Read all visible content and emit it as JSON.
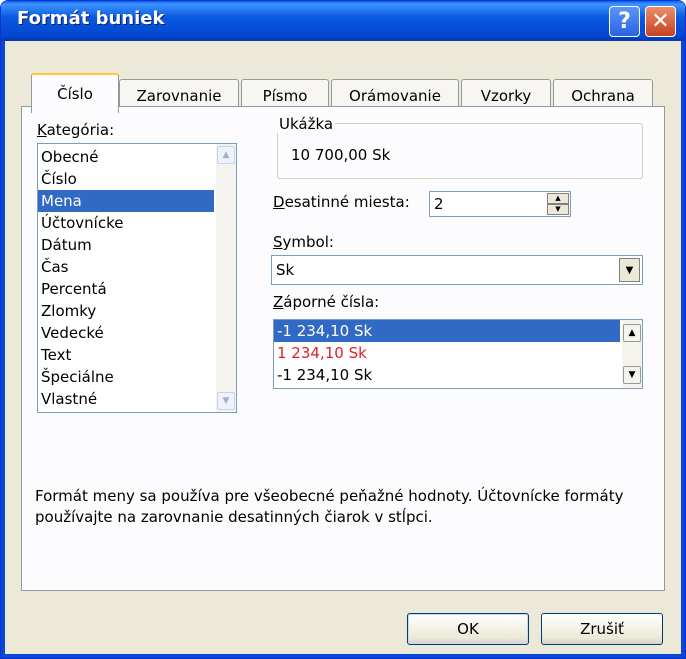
{
  "window": {
    "title": "Formát buniek",
    "help_glyph": "?",
    "close_glyph": "✕"
  },
  "tabs": [
    {
      "label": "Číslo",
      "active": true
    },
    {
      "label": "Zarovnanie",
      "active": false
    },
    {
      "label": "Písmo",
      "active": false
    },
    {
      "label": "Orámovanie",
      "active": false
    },
    {
      "label": "Vzorky",
      "active": false
    },
    {
      "label": "Ochrana",
      "active": false
    }
  ],
  "category": {
    "label": "Kategória:",
    "items": [
      "Obecné",
      "Číslo",
      "Mena",
      "Účtovnícke",
      "Dátum",
      "Čas",
      "Percentá",
      "Zlomky",
      "Vedecké",
      "Text",
      "Špeciálne",
      "Vlastné"
    ],
    "selected": "Mena"
  },
  "sample": {
    "label": "Ukážka",
    "value": "10 700,00 Sk"
  },
  "decimals": {
    "label": "Desatinné miesta:",
    "value": "2"
  },
  "symbol": {
    "label": "Symbol:",
    "value": "Sk"
  },
  "negative": {
    "label": "Záporné čísla:",
    "items": [
      {
        "text": "-1 234,10 Sk",
        "color": "#ffffff",
        "selected": true
      },
      {
        "text": "1 234,10 Sk",
        "color": "#e02020",
        "selected": false
      },
      {
        "text": "-1 234,10 Sk",
        "color": "#000000",
        "selected": false
      }
    ]
  },
  "description": "Formát meny sa používa pre všeobecné peňažné hodnoty. Účtovnícke formáty používajte na zarovnanie desatinných čiarok v stĺpci.",
  "buttons": {
    "ok": "OK",
    "cancel": "Zrušiť"
  },
  "colors": {
    "selection": "#316ac5",
    "negative_red": "#e02020",
    "dialog_bg": "#ece9d8",
    "title_blue": "#0a5ae0"
  }
}
